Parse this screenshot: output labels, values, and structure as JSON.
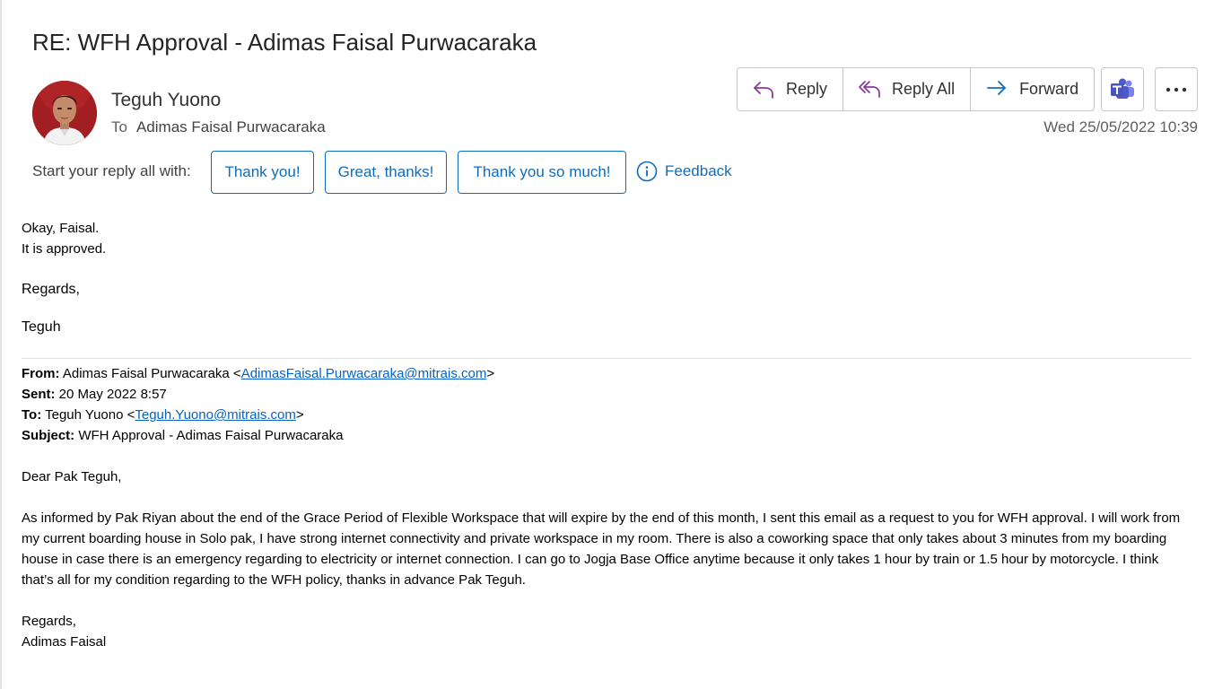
{
  "email": {
    "subject": "RE: WFH Approval - Adimas Faisal Purwacaraka",
    "sender": "Teguh Yuono",
    "to_label": "To",
    "to": "Adimas Faisal Purwacaraka",
    "date": "Wed 25/05/2022 10:39"
  },
  "toolbar": {
    "reply_label": "Reply",
    "reply_all_label": "Reply All",
    "forward_label": "Forward",
    "teams_icon": "teams-icon",
    "more_icon": "more-options-icon"
  },
  "quick_replies": {
    "label": "Start your reply all with:",
    "options": [
      "Thank you!",
      "Great, thanks!",
      "Thank you so much!"
    ],
    "feedback_label": "Feedback"
  },
  "body": {
    "line1": "Okay, Faisal.",
    "line2": "It is approved.",
    "regards": "Regards,",
    "signature": "Teguh"
  },
  "quoted": {
    "from_label": "From:",
    "from_name": "Adimas Faisal Purwacaraka",
    "from_email": "AdimasFaisal.Purwacaraka@mitrais.com",
    "sent_label": "Sent:",
    "sent": "20 May 2022 8:57",
    "to_label": "To:",
    "to_name": "Teguh Yuono",
    "to_email": "Teguh.Yuono@mitrais.com",
    "subject_label": "Subject:",
    "subject": "WFH Approval - Adimas Faisal Purwacaraka",
    "greeting": "Dear Pak Teguh,",
    "paragraph": "As informed by Pak Riyan about the end of the Grace Period of Flexible Workspace that will expire by the end of this month, I sent this email as a request to you for WFH approval. I will work from my current boarding house in Solo pak, I have strong internet connectivity and private workspace in my room. There is also a coworking space that only takes about 3 minutes from my boarding house in case there is an emergency regarding to electricity or internet connection. I can go to Jogja Base Office anytime because it only takes 1 hour by train or 1.5 hour by motorcycle. I think that’s all for my condition regarding to the WFH policy, thanks in advance Pak Teguh.",
    "regards": "Regards,",
    "signature": "Adimas Faisal"
  },
  "colors": {
    "accent": "#0f6cbd",
    "reply_icon": "#8a3b9a",
    "forward_icon": "#0f6cbd",
    "link": "#0563c1"
  }
}
